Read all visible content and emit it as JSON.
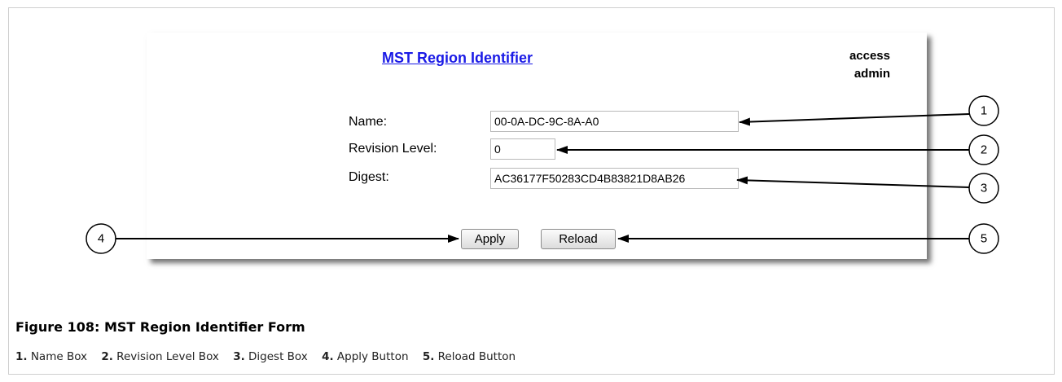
{
  "form": {
    "title": "MST Region Identifier",
    "access": {
      "line1": "access",
      "line2": "admin"
    },
    "fields": [
      {
        "label": "Name:",
        "value": "00-0A-DC-9C-8A-A0"
      },
      {
        "label": "Revision Level:",
        "value": "0"
      },
      {
        "label": "Digest:",
        "value": "AC36177F50283CD4B83821D8AB26"
      }
    ],
    "buttons": {
      "apply": "Apply",
      "reload": "Reload"
    }
  },
  "callouts": [
    "1",
    "2",
    "3",
    "4",
    "5"
  ],
  "figure": {
    "caption": "Figure 108: MST Region Identifier Form",
    "legend": [
      {
        "num": "1.",
        "text": "Name Box"
      },
      {
        "num": "2.",
        "text": "Revision Level Box"
      },
      {
        "num": "3.",
        "text": "Digest Box"
      },
      {
        "num": "4.",
        "text": "Apply Button"
      },
      {
        "num": "5.",
        "text": "Reload Button"
      }
    ]
  }
}
